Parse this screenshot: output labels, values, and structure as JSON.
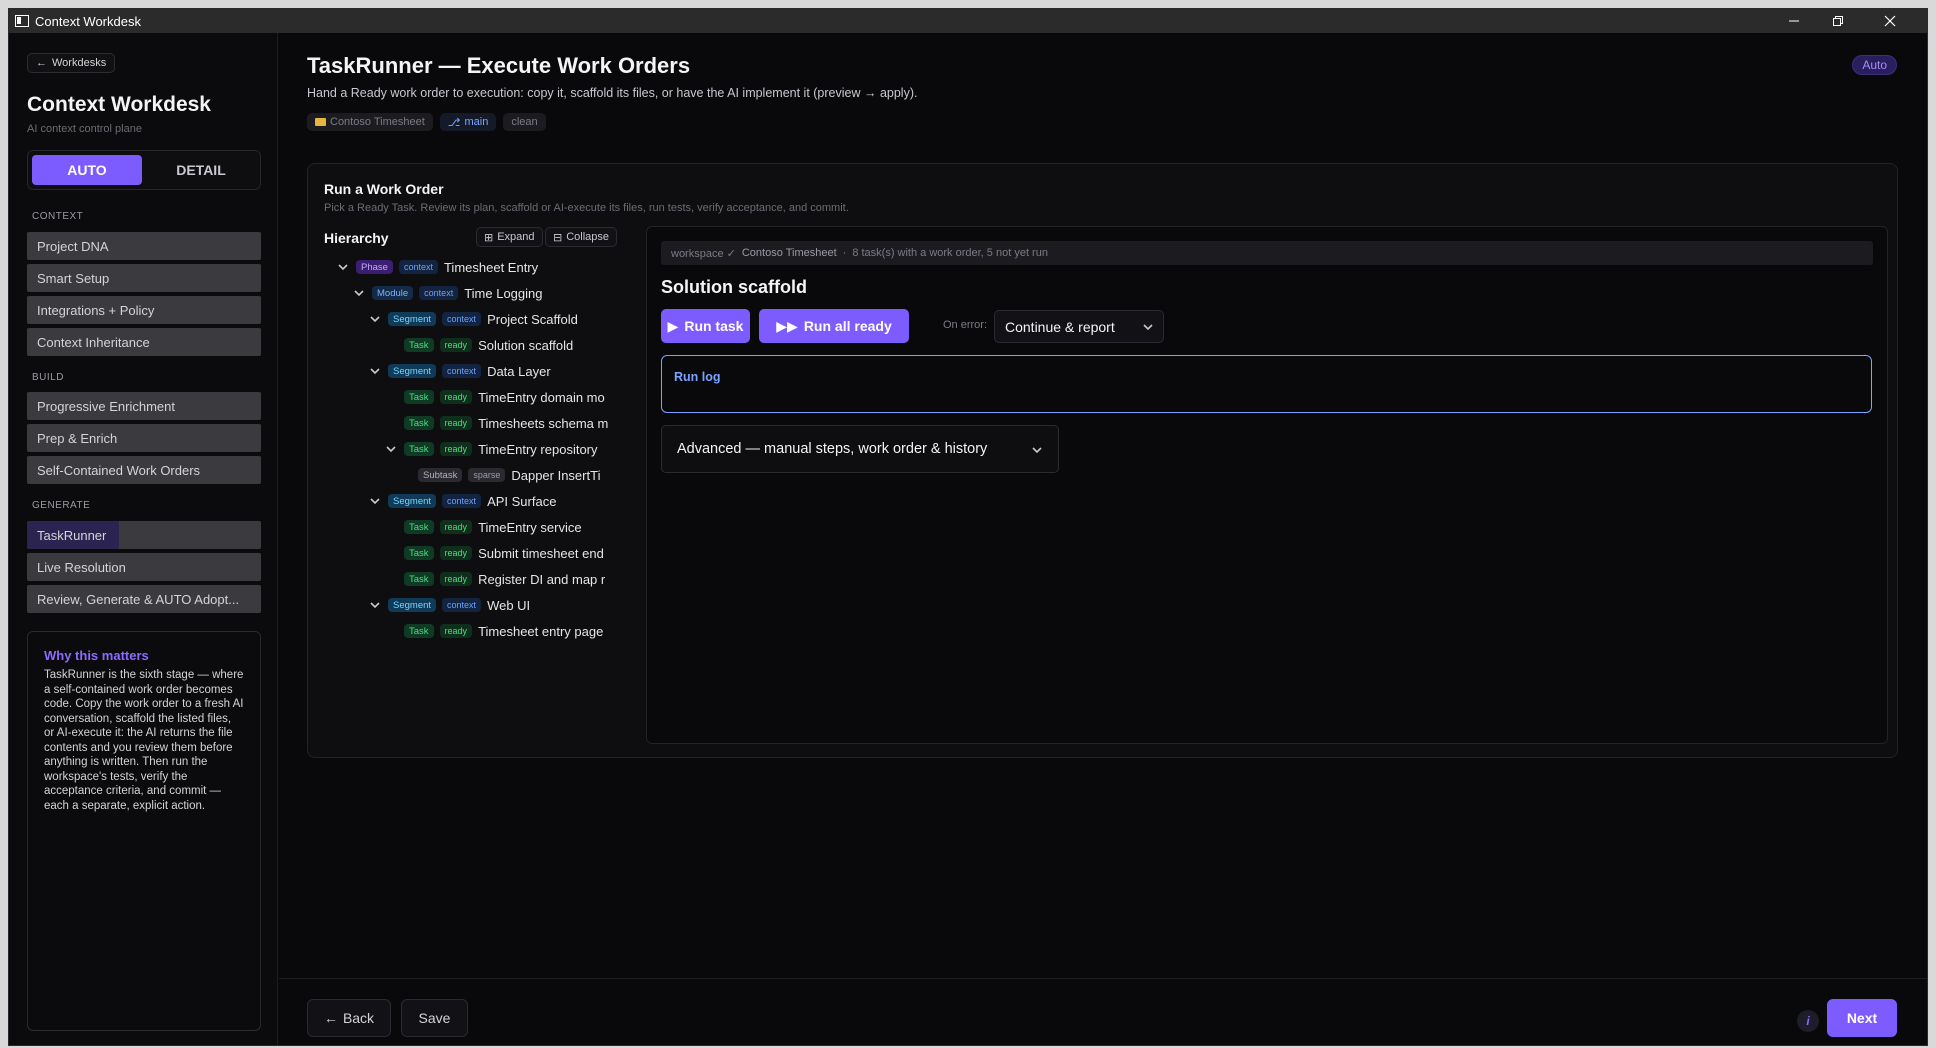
{
  "window": {
    "title": "Context Workdesk"
  },
  "sidebar": {
    "back_label": "Workdesks",
    "title": "Context Workdesk",
    "subtitle": "AI context control plane",
    "modes": [
      "AUTO",
      "DETAIL"
    ],
    "active_mode": "AUTO",
    "sections": [
      {
        "label": "CONTEXT",
        "items": [
          "Project DNA",
          "Smart Setup",
          "Integrations + Policy",
          "Context Inheritance"
        ]
      },
      {
        "label": "BUILD",
        "items": [
          "Progressive Enrichment",
          "Prep & Enrich",
          "Self-Contained Work Orders"
        ]
      },
      {
        "label": "GENERATE",
        "items": [
          "TaskRunner",
          "Live Resolution",
          "Review, Generate & AUTO Adopt..."
        ]
      }
    ],
    "active_item": "TaskRunner",
    "why": {
      "title": "Why this matters",
      "text": "TaskRunner is the sixth stage — where a self-contained work order becomes code. Copy the work order to a fresh AI conversation, scaffold the listed files, or AI-execute it: the AI returns the file contents and you review them before anything is written. Then run the workspace's tests, verify the acceptance criteria, and commit — each a separate, explicit action."
    }
  },
  "main": {
    "title": "TaskRunner — Execute Work Orders",
    "description": "Hand a Ready work order to execution: copy it, scaffold its files, or have the AI implement it (preview → apply).",
    "mode_badge": "Auto",
    "chips": {
      "project": "Contoso Timesheet",
      "branch": "main",
      "status": "clean"
    },
    "panel": {
      "title": "Run a Work Order",
      "subtitle": "Pick a Ready Task. Review its plan, scaffold or AI-execute its files, run tests, verify acceptance, and commit."
    },
    "hierarchy": {
      "title": "Hierarchy",
      "expand_label": "Expand",
      "collapse_label": "Collapse",
      "nodes": [
        {
          "depth": 0,
          "expanded": true,
          "type": "Phase",
          "tag": "context",
          "label": "Timesheet Entry"
        },
        {
          "depth": 1,
          "expanded": true,
          "type": "Module",
          "tag": "context",
          "label": "Time Logging"
        },
        {
          "depth": 2,
          "expanded": true,
          "type": "Segment",
          "tag": "context",
          "label": "Project Scaffold"
        },
        {
          "depth": 3,
          "expanded": null,
          "type": "Task",
          "tag": "ready",
          "label": "Solution scaffold"
        },
        {
          "depth": 2,
          "expanded": true,
          "type": "Segment",
          "tag": "context",
          "label": "Data Layer"
        },
        {
          "depth": 3,
          "expanded": null,
          "type": "Task",
          "tag": "ready",
          "label": "TimeEntry domain mo"
        },
        {
          "depth": 3,
          "expanded": null,
          "type": "Task",
          "tag": "ready",
          "label": "Timesheets schema m"
        },
        {
          "depth": 3,
          "expanded": true,
          "type": "Task",
          "tag": "ready",
          "label": "TimeEntry repository"
        },
        {
          "depth": 4,
          "expanded": null,
          "type": "Subtask",
          "tag": "sparse",
          "label": "Dapper InsertTi"
        },
        {
          "depth": 2,
          "expanded": true,
          "type": "Segment",
          "tag": "context",
          "label": "API Surface"
        },
        {
          "depth": 3,
          "expanded": null,
          "type": "Task",
          "tag": "ready",
          "label": "TimeEntry service"
        },
        {
          "depth": 3,
          "expanded": null,
          "type": "Task",
          "tag": "ready",
          "label": "Submit timesheet end"
        },
        {
          "depth": 3,
          "expanded": null,
          "type": "Task",
          "tag": "ready",
          "label": "Register DI and map r"
        },
        {
          "depth": 2,
          "expanded": true,
          "type": "Segment",
          "tag": "context",
          "label": "Web UI"
        },
        {
          "depth": 3,
          "expanded": null,
          "type": "Task",
          "tag": "ready",
          "label": "Timesheet entry page"
        }
      ]
    },
    "detail": {
      "workspace_label": "workspace ✓",
      "workspace_name": "Contoso Timesheet",
      "workspace_summary": "8 task(s) with a work order, 5 not yet run",
      "title": "Solution scaffold",
      "run_task_label": "Run task",
      "run_all_label": "Run all ready",
      "on_error_label": "On error:",
      "on_error_value": "Continue & report",
      "run_log_label": "Run log",
      "advanced_label": "Advanced — manual steps, work order & history"
    }
  },
  "footer": {
    "back_label": "Back",
    "save_label": "Save",
    "info_label": "i",
    "next_label": "Next"
  },
  "colors": {
    "accent": "#7c5cff",
    "background": "#09090b",
    "run_log_border": "#7aa2ff"
  }
}
